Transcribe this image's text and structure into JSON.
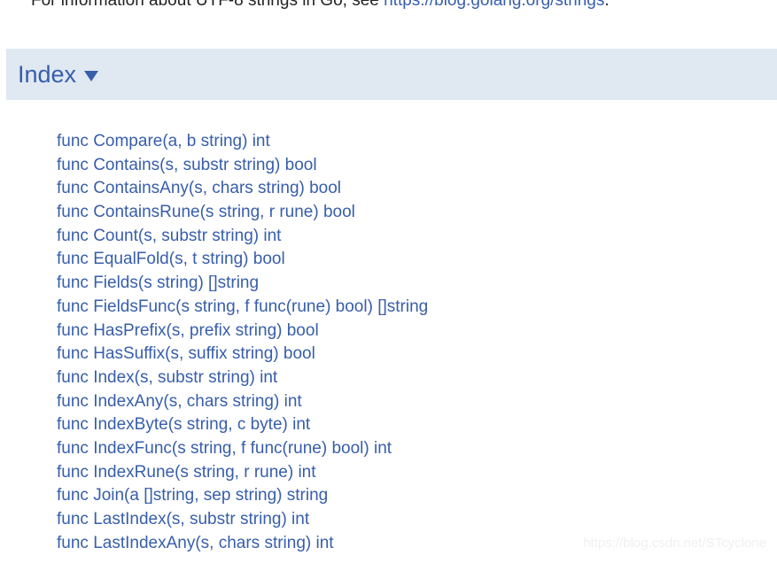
{
  "intro": {
    "text_before": "For information about UTF-8 strings in Go, see ",
    "link_text": "https://blog.golang.org/strings",
    "text_after": "."
  },
  "index_panel": {
    "title": "Index",
    "caret": "chevron-down-icon",
    "background_color": "#e0e8f2",
    "link_color": "#375eab"
  },
  "functions": [
    {
      "label": "func Compare(a, b string) int"
    },
    {
      "label": "func Contains(s, substr string) bool"
    },
    {
      "label": "func ContainsAny(s, chars string) bool"
    },
    {
      "label": "func ContainsRune(s string, r rune) bool"
    },
    {
      "label": "func Count(s, substr string) int"
    },
    {
      "label": "func EqualFold(s, t string) bool"
    },
    {
      "label": "func Fields(s string) []string"
    },
    {
      "label": "func FieldsFunc(s string, f func(rune) bool) []string"
    },
    {
      "label": "func HasPrefix(s, prefix string) bool"
    },
    {
      "label": "func HasSuffix(s, suffix string) bool"
    },
    {
      "label": "func Index(s, substr string) int"
    },
    {
      "label": "func IndexAny(s, chars string) int"
    },
    {
      "label": "func IndexByte(s string, c byte) int"
    },
    {
      "label": "func IndexFunc(s string, f func(rune) bool) int"
    },
    {
      "label": "func IndexRune(s string, r rune) int"
    },
    {
      "label": "func Join(a []string, sep string) string"
    },
    {
      "label": "func LastIndex(s, substr string) int"
    },
    {
      "label": "func LastIndexAny(s, chars string) int"
    }
  ],
  "watermark": {
    "text": "https://blog.csdn.net/STcyclone"
  }
}
